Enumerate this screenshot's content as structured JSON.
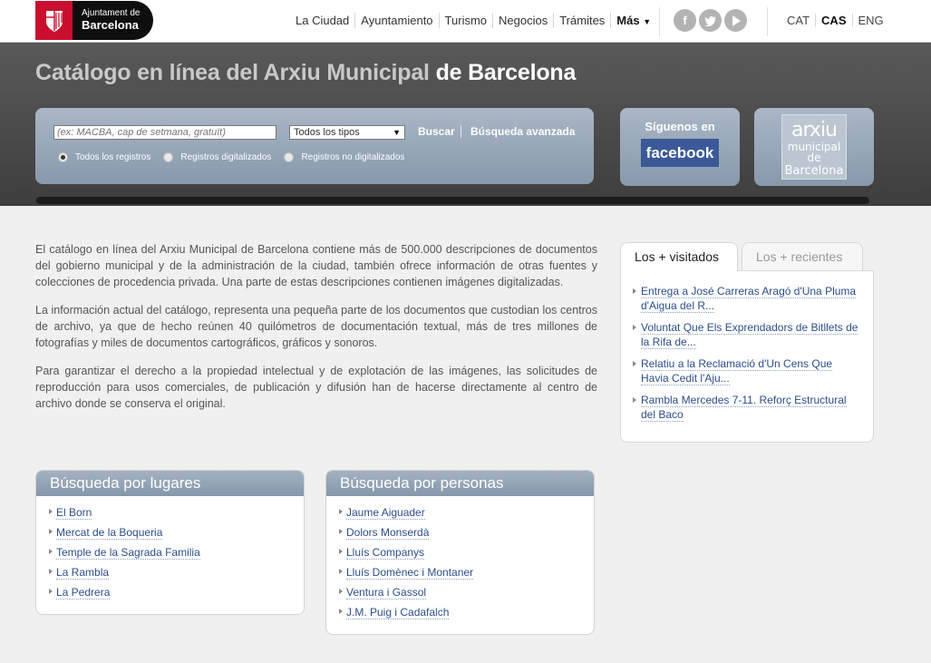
{
  "brand": {
    "line1": "Ajuntament de",
    "line2": "Barcelona",
    "accent": "#c8102e"
  },
  "nav": {
    "items": [
      "La Ciudad",
      "Ayuntamiento",
      "Turismo",
      "Negocios",
      "Trámites"
    ],
    "more": "Más"
  },
  "social": {
    "items": [
      "facebook-icon",
      "twitter-icon",
      "youtube-icon"
    ]
  },
  "languages": {
    "items": [
      "CAT",
      "CAS",
      "ENG"
    ],
    "active": "CAS"
  },
  "header": {
    "title_light": "Catálogo en línea del Arxiu Municipal",
    "title_bold": "de Barcelona"
  },
  "search": {
    "placeholder": "(ex: MACBA, cap de setmana, gratuït)",
    "type_selected": "Todos los tipos",
    "submit_label": "Buscar",
    "advanced_label": "Búsqueda avanzada",
    "radios": [
      {
        "label": "Todos los registros",
        "checked": true
      },
      {
        "label": "Registros digitalizados",
        "checked": false
      },
      {
        "label": "Registros no digitalizados",
        "checked": false
      }
    ]
  },
  "facebook_promo": {
    "label": "Síguenos en",
    "brand": "facebook"
  },
  "arxiu_logo": {
    "line1": "arxiu",
    "line2": "municipal de",
    "line3": "Barcelona"
  },
  "intro": {
    "paragraphs": [
      "El catálogo en línea del Arxiu Municipal de Barcelona contiene más de 500.000 descripciones de documentos del gobierno municipal y de la administración de la ciudad, también ofrece información de otras fuentes y colecciones de procedencia privada. Una parte de estas descripciones contienen imágenes digitalizadas.",
      "La información actual del catálogo, representa una pequeña parte de los documentos que custodian los centros de archivo, ya que de hecho reúnen 40 quilómetros de documentación textual, más de tres millones de fotografías y miles de documentos cartográficos, gráficos y sonoros.",
      "Para garantizar el derecho a la propiedad intelectual y de explotación de las imágenes, las solicitudes de reproducción para usos comerciales, de publicación y difusión han de hacerse directamente al centro de archivo donde se conserva el original."
    ]
  },
  "tabs": {
    "items": [
      "Los + visitados",
      "Los + recientes"
    ],
    "active": "Los + visitados",
    "visited": [
      "Entrega a José Carreras Aragó d'Una Pluma d'Aigua del R...",
      "Voluntat Que Els Exprendadors de Bitllets de la Rifa de...",
      "Relatiu a la Reclamació d'Un Cens Que Havia Cedit l'Aju...",
      "Rambla Mercedes 7-11. Reforç Estructural del Baco"
    ]
  },
  "places": {
    "title": "Búsqueda por lugares",
    "items": [
      "El Born",
      "Mercat de la Boqueria",
      "Temple de la Sagrada Familia",
      "La Rambla",
      "La Pedrera"
    ]
  },
  "people": {
    "title": "Búsqueda por personas",
    "items": [
      "Jaume Aiguader",
      "Dolors Monserdà",
      "Lluís Companys",
      "Lluís Domènec i Montaner",
      "Ventura i Gassol",
      "J.M. Puig i Cadafalch"
    ]
  }
}
